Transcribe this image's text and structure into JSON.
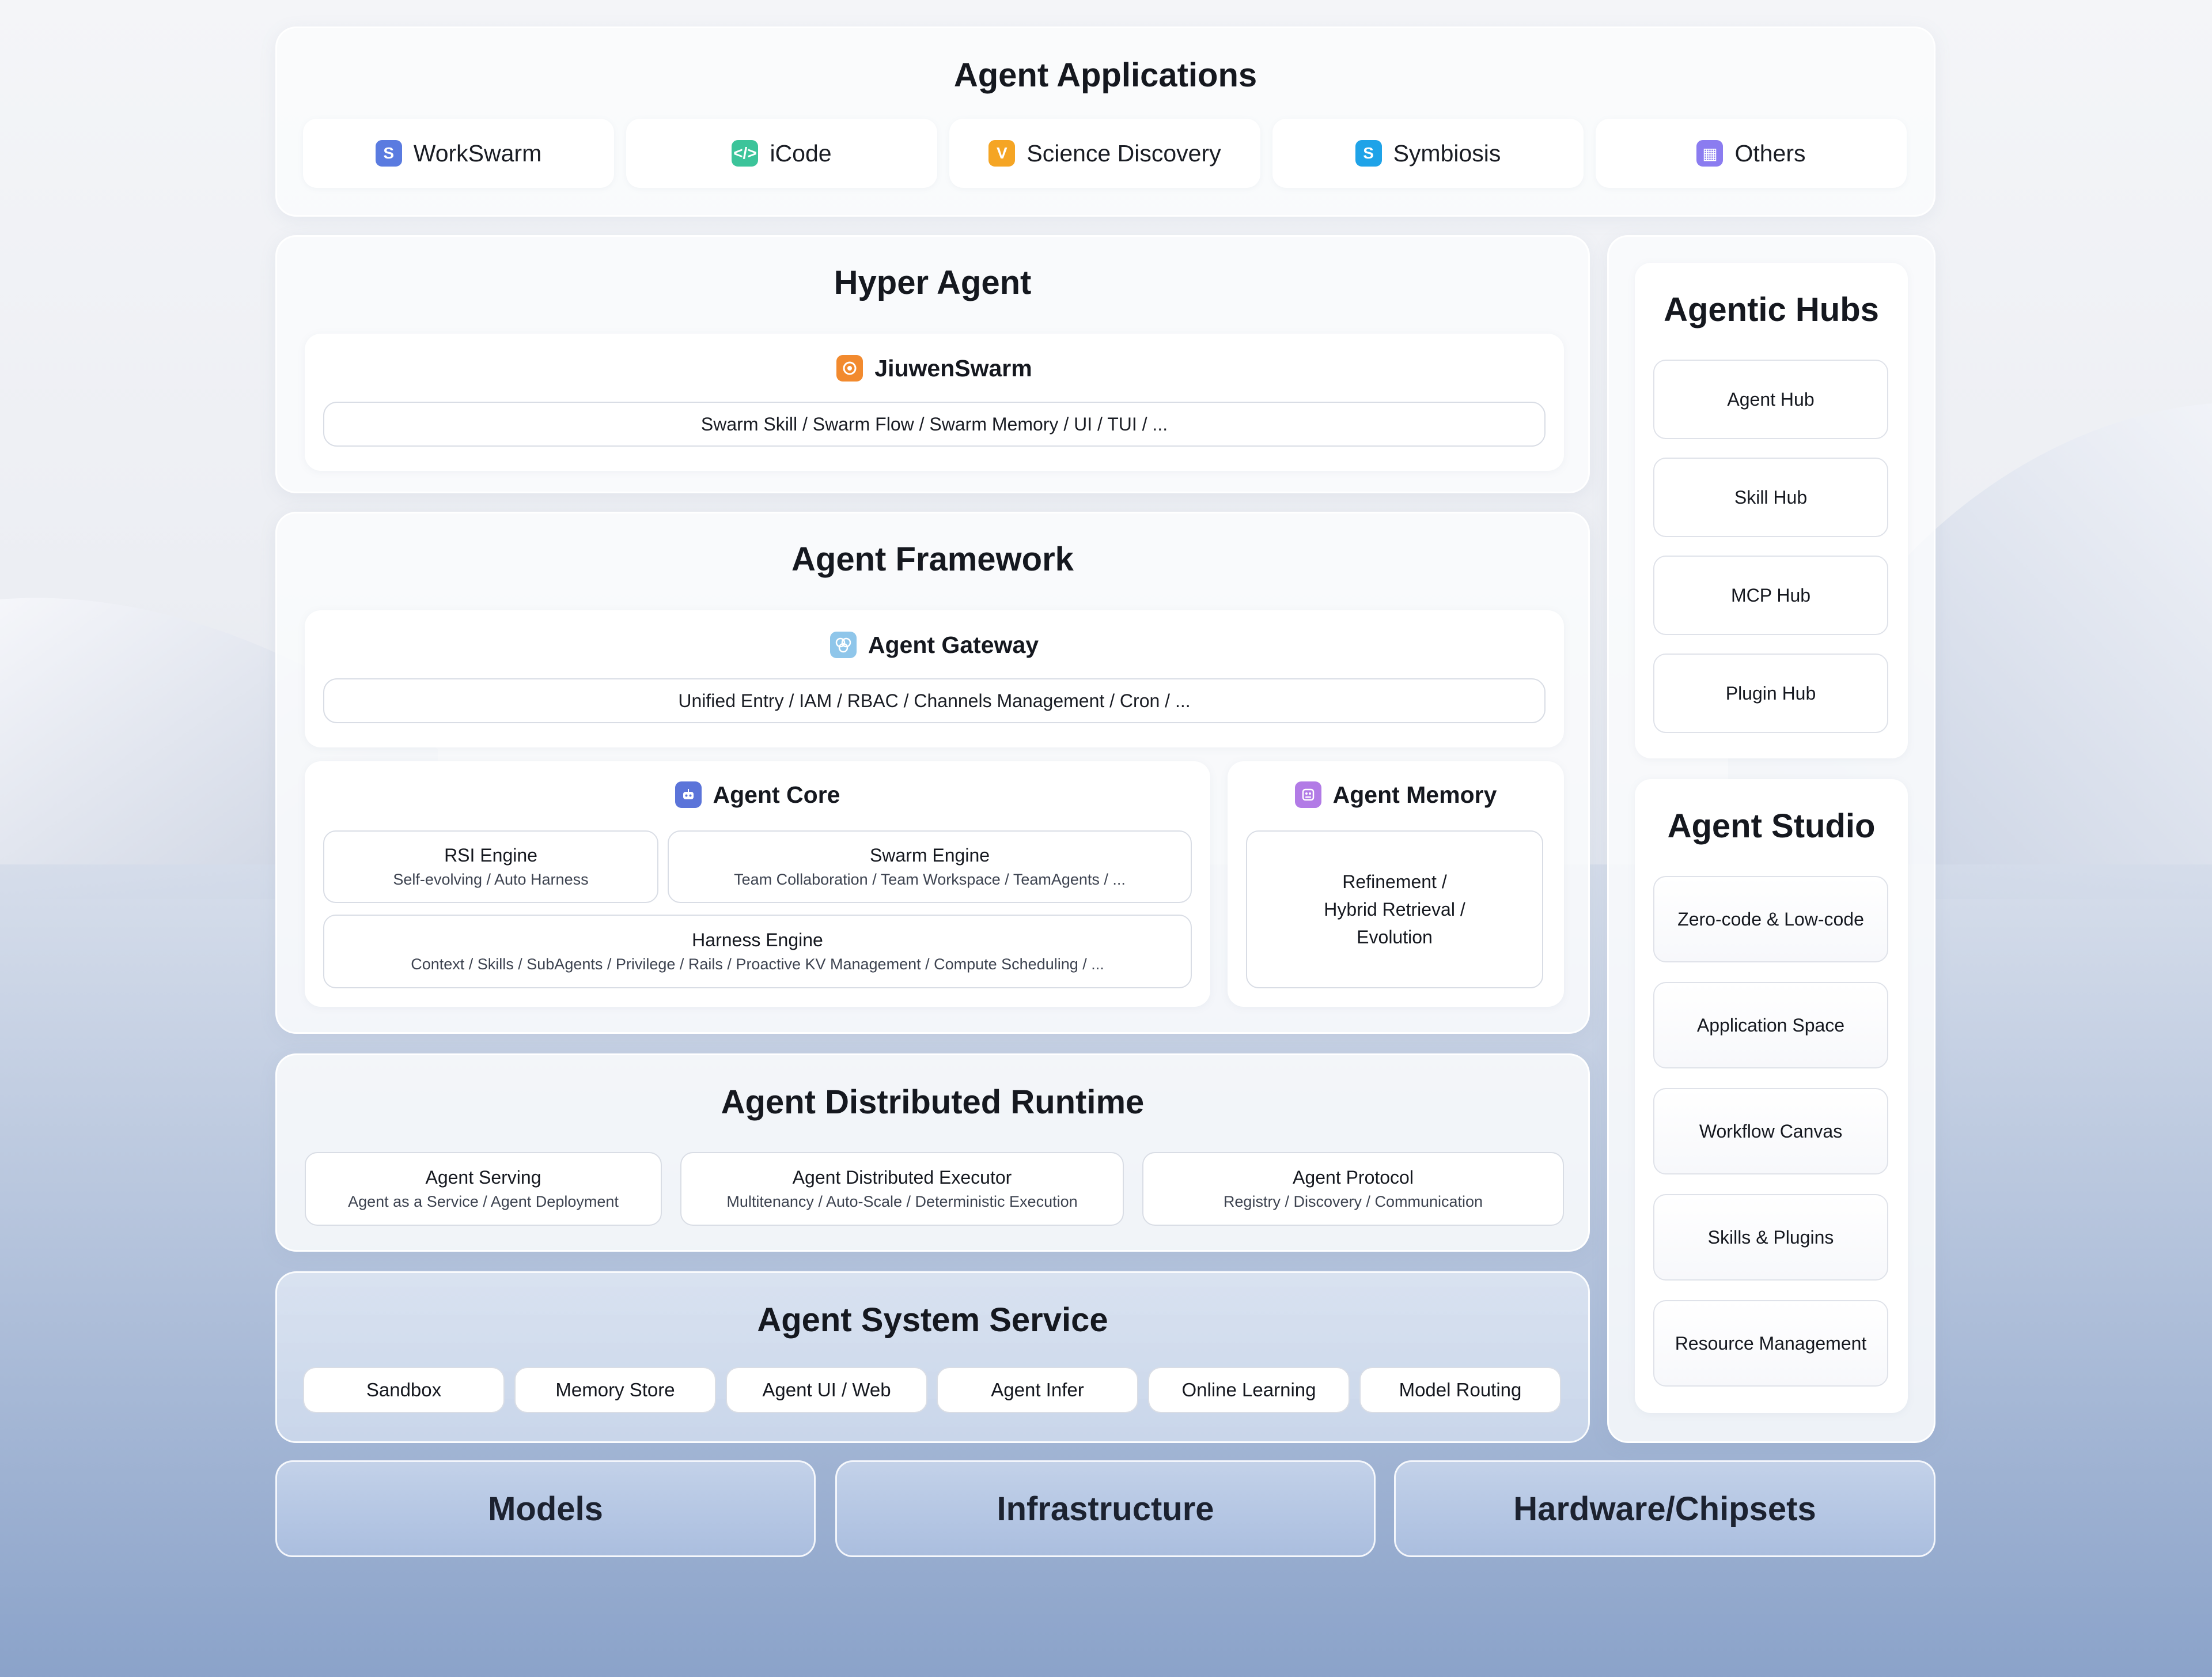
{
  "agent_applications": {
    "title": "Agent Applications",
    "apps": [
      {
        "label": "WorkSwarm",
        "icon": "workswarm-s-icon",
        "color": "#5a7be0",
        "glyph": "S"
      },
      {
        "label": "iCode",
        "icon": "code-icon",
        "color": "#3cc49a",
        "glyph": "</>"
      },
      {
        "label": "Science Discovery",
        "icon": "science-v-icon",
        "color": "#f5a524",
        "glyph": "V"
      },
      {
        "label": "Symbiosis",
        "icon": "symbiosis-s-icon",
        "color": "#1fa3e8",
        "glyph": "S"
      },
      {
        "label": "Others",
        "icon": "grid-icon",
        "color": "#8b7cf0",
        "glyph": "▦"
      }
    ]
  },
  "hyper_agent": {
    "title": "Hyper Agent",
    "jiuwen": {
      "title": "JiuwenSwarm",
      "icon": "swarm-icon",
      "color": "#f28a2e",
      "desc": "Swarm Skill / Swarm Flow / Swarm Memory / UI / TUI / ..."
    }
  },
  "agent_framework": {
    "title": "Agent Framework",
    "gateway": {
      "title": "Agent Gateway",
      "icon": "gateway-icon",
      "color": "#8fc6ea",
      "desc": "Unified Entry / IAM / RBAC / Channels Management / Cron / ..."
    },
    "core": {
      "title": "Agent Core",
      "icon": "robot-icon",
      "color": "#5b74d9",
      "rsi": {
        "title": "RSI Engine",
        "desc": "Self-evolving / Auto Harness"
      },
      "swarm": {
        "title": "Swarm Engine",
        "desc": "Team Collaboration / Team Workspace / TeamAgents / ..."
      },
      "harness": {
        "title": "Harness Engine",
        "desc": "Context / Skills / SubAgents / Privilege / Rails / Proactive KV Management / Compute Scheduling / ..."
      }
    },
    "memory": {
      "title": "Agent Memory",
      "icon": "memory-icon",
      "color": "#b27be6",
      "lines": [
        "Refinement /",
        "Hybrid Retrieval /",
        "Evolution"
      ]
    }
  },
  "distributed_runtime": {
    "title": "Agent Distributed Runtime",
    "items": [
      {
        "title": "Agent Serving",
        "desc": "Agent as a Service / Agent Deployment"
      },
      {
        "title": "Agent Distributed Executor",
        "desc": "Multitenancy / Auto-Scale / Deterministic Execution"
      },
      {
        "title": "Agent Protocol",
        "desc": "Registry / Discovery / Communication"
      }
    ]
  },
  "system_service": {
    "title": "Agent System Service",
    "items": [
      "Sandbox",
      "Memory Store",
      "Agent UI / Web",
      "Agent Infer",
      "Online Learning",
      "Model Routing"
    ]
  },
  "base_layers": [
    "Models",
    "Infrastructure",
    "Hardware/Chipsets"
  ],
  "agentic_hubs": {
    "title": "Agentic Hubs",
    "items": [
      "Agent Hub",
      "Skill Hub",
      "MCP Hub",
      "Plugin Hub"
    ]
  },
  "agent_studio": {
    "title": "Agent Studio",
    "items": [
      "Zero-code & Low-code",
      "Application Space",
      "Workflow Canvas",
      "Skills & Plugins",
      "Resource Management"
    ]
  }
}
